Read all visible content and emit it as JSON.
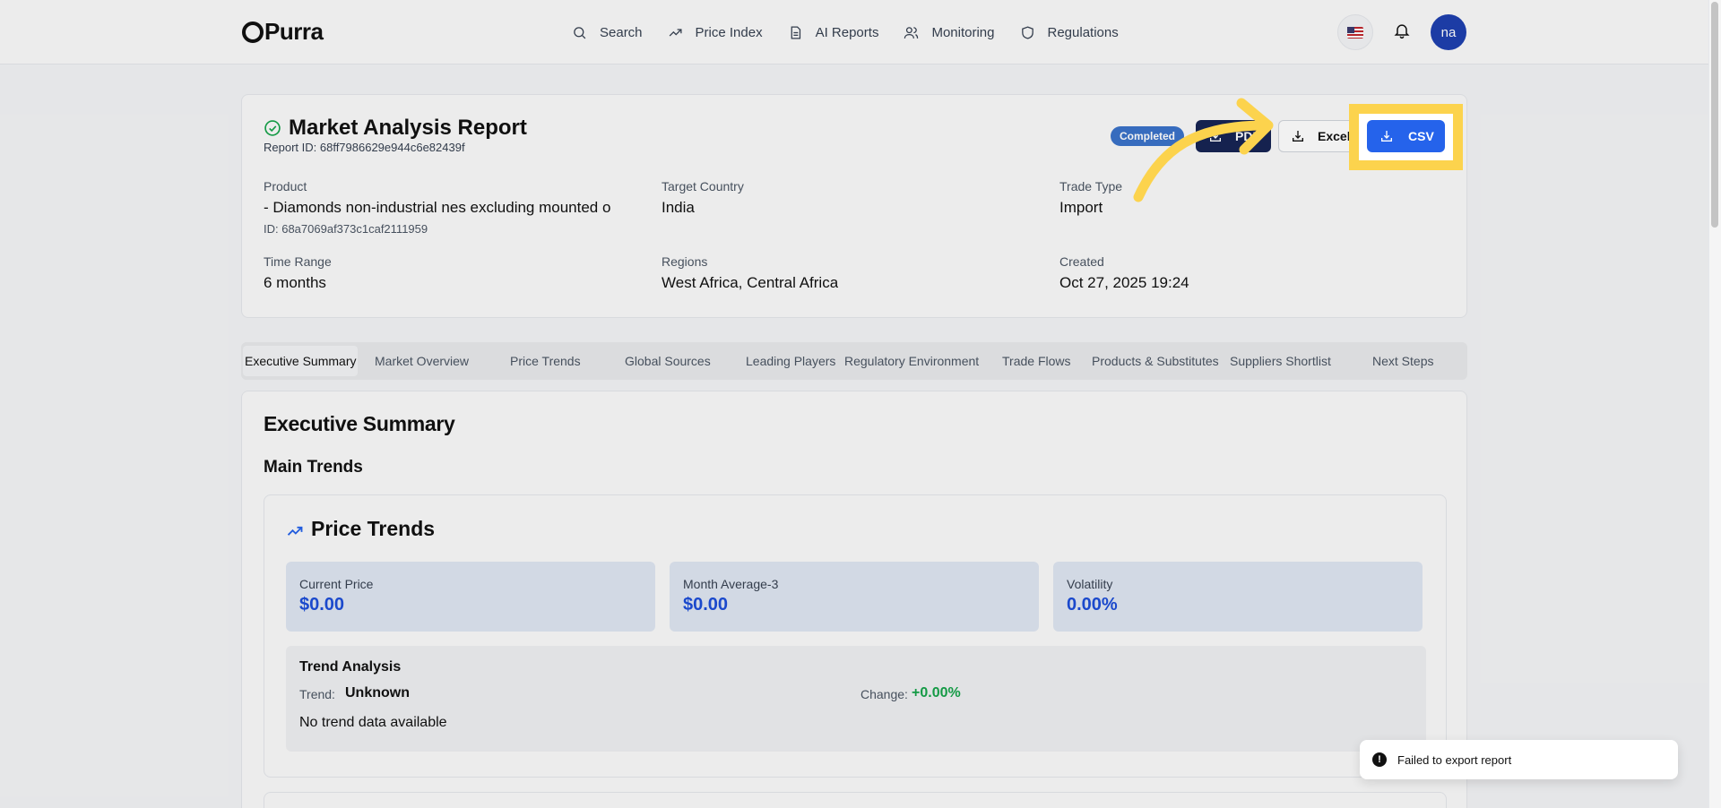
{
  "app": {
    "logo": "Purra"
  },
  "nav": {
    "items": [
      {
        "label": "Search",
        "icon": "search-icon"
      },
      {
        "label": "Price Index",
        "icon": "trending-up-icon"
      },
      {
        "label": "AI Reports",
        "icon": "document-icon"
      },
      {
        "label": "Monitoring",
        "icon": "users-icon"
      },
      {
        "label": "Regulations",
        "icon": "shield-icon"
      }
    ],
    "avatar_initials": "na",
    "locale_flag": "us-flag-icon"
  },
  "report": {
    "title": "Market Analysis Report",
    "id_text": "Report ID: 68ff7986629e944c6e82439f",
    "status": "Completed",
    "buttons": {
      "pdf": "PDF",
      "excel": "Excel",
      "csv": "CSV"
    },
    "fields": {
      "product_label": "Product",
      "product_value": "- Diamonds non-industrial nes excluding mounted o",
      "product_id": "ID: 68a7069af373c1caf2111959",
      "country_label": "Target Country",
      "country_value": "India",
      "trade_label": "Trade Type",
      "trade_value": "Import",
      "range_label": "Time Range",
      "range_value": "6 months",
      "regions_label": "Regions",
      "regions_value": "West Africa, Central Africa",
      "created_label": "Created",
      "created_value": "Oct 27, 2025 19:24"
    }
  },
  "tabs": [
    "Executive Summary",
    "Market Overview",
    "Price Trends",
    "Global Sources",
    "Leading Players",
    "Regulatory Environment",
    "Trade Flows",
    "Products & Substitutes",
    "Suppliers Shortlist",
    "Next Steps"
  ],
  "summary": {
    "title": "Executive Summary",
    "main_trends": "Main Trends",
    "price_trends": {
      "title": "Price Trends",
      "metrics": [
        {
          "label": "Current Price",
          "value": "$0.00"
        },
        {
          "label": "Month Average-3",
          "value": "$0.00"
        },
        {
          "label": "Volatility",
          "value": "0.00%"
        }
      ],
      "analysis": {
        "title": "Trend Analysis",
        "trend_label": "Trend:",
        "trend_value": "Unknown",
        "change_label": "Change:",
        "change_value": "+0.00%",
        "note": "No trend data available"
      }
    }
  },
  "toast": {
    "message": "Failed to export report"
  },
  "colors": {
    "accent": "#2563eb",
    "highlight": "#fcd34d",
    "navy": "#172554",
    "success": "#16a34a"
  }
}
